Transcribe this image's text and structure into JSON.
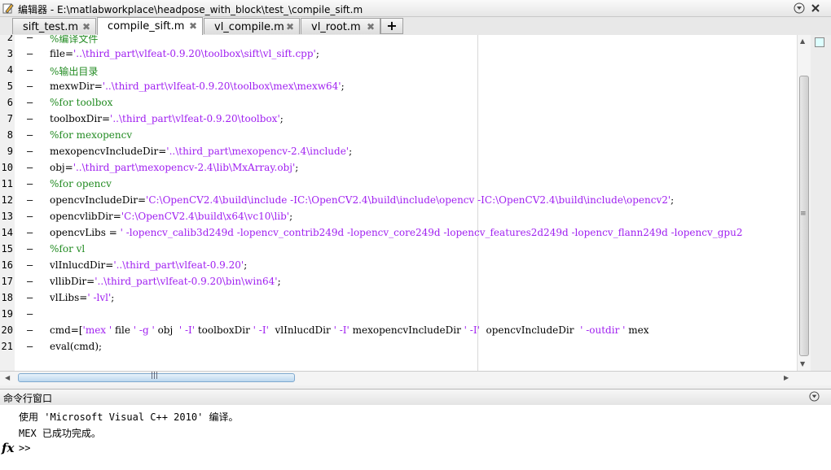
{
  "window": {
    "title": "编辑器 - E:\\matlabworkplace\\headpose_with_block\\test_\\compile_sift.m",
    "menu_icon": "chevron-down-icon",
    "close_icon": "close-icon"
  },
  "tabs": [
    {
      "label": "sift_test.m",
      "active": false
    },
    {
      "label": "compile_sift.m",
      "active": true
    },
    {
      "label": "vl_compile.m",
      "active": false
    },
    {
      "label": "vl_root.m",
      "active": false
    }
  ],
  "tab_close_glyph": "✖",
  "add_tab_label": "+",
  "editor": {
    "lines": [
      {
        "num": "2",
        "segments": [
          {
            "t": "cmt",
            "v": "%编译文件"
          }
        ]
      },
      {
        "num": "3",
        "segments": [
          {
            "t": "plain",
            "v": "file="
          },
          {
            "t": "str",
            "v": "'..\\third_part\\vlfeat-0.9.20\\toolbox\\sift\\vl_sift.cpp'"
          },
          {
            "t": "plain",
            "v": ";"
          }
        ]
      },
      {
        "num": "4",
        "segments": [
          {
            "t": "cmt",
            "v": "%输出目录"
          }
        ]
      },
      {
        "num": "5",
        "segments": [
          {
            "t": "plain",
            "v": "mexwDir="
          },
          {
            "t": "str",
            "v": "'..\\third_part\\vlfeat-0.9.20\\toolbox\\mex\\mexw64'"
          },
          {
            "t": "plain",
            "v": ";"
          }
        ]
      },
      {
        "num": "6",
        "segments": [
          {
            "t": "cmt",
            "v": "%for toolbox"
          }
        ]
      },
      {
        "num": "7",
        "segments": [
          {
            "t": "plain",
            "v": "toolboxDir="
          },
          {
            "t": "str",
            "v": "'..\\third_part\\vlfeat-0.9.20\\toolbox'"
          },
          {
            "t": "plain",
            "v": ";"
          }
        ]
      },
      {
        "num": "8",
        "segments": [
          {
            "t": "cmt",
            "v": "%for mexopencv"
          }
        ]
      },
      {
        "num": "9",
        "segments": [
          {
            "t": "plain",
            "v": "mexopencvIncludeDir="
          },
          {
            "t": "str",
            "v": "'..\\third_part\\mexopencv-2.4\\include'"
          },
          {
            "t": "plain",
            "v": ";"
          }
        ]
      },
      {
        "num": "10",
        "segments": [
          {
            "t": "plain",
            "v": "obj="
          },
          {
            "t": "str",
            "v": "'..\\third_part\\mexopencv-2.4\\lib\\MxArray.obj'"
          },
          {
            "t": "plain",
            "v": ";"
          }
        ]
      },
      {
        "num": "11",
        "segments": [
          {
            "t": "cmt",
            "v": "%for opencv"
          }
        ]
      },
      {
        "num": "12",
        "segments": [
          {
            "t": "plain",
            "v": "opencvIncludeDir="
          },
          {
            "t": "str",
            "v": "'C:\\OpenCV2.4\\build\\include -IC:\\OpenCV2.4\\build\\include\\opencv -IC:\\OpenCV2.4\\build\\include\\opencv2'"
          },
          {
            "t": "plain",
            "v": ";"
          }
        ]
      },
      {
        "num": "13",
        "segments": [
          {
            "t": "plain",
            "v": "opencvlibDir="
          },
          {
            "t": "str",
            "v": "'C:\\OpenCV2.4\\build\\x64\\vc10\\lib'"
          },
          {
            "t": "plain",
            "v": ";"
          }
        ]
      },
      {
        "num": "14",
        "segments": [
          {
            "t": "plain",
            "v": "opencvLibs = "
          },
          {
            "t": "str",
            "v": "' -lopencv_calib3d249d -lopencv_contrib249d -lopencv_core249d -lopencv_features2d249d -lopencv_flann249d -lopencv_gpu2"
          }
        ]
      },
      {
        "num": "15",
        "segments": [
          {
            "t": "cmt",
            "v": "%for vl"
          }
        ]
      },
      {
        "num": "16",
        "segments": [
          {
            "t": "plain",
            "v": "vlInlucdDir="
          },
          {
            "t": "str",
            "v": "'..\\third_part\\vlfeat-0.9.20'"
          },
          {
            "t": "plain",
            "v": ";"
          }
        ]
      },
      {
        "num": "17",
        "segments": [
          {
            "t": "plain",
            "v": "vllibDir="
          },
          {
            "t": "str",
            "v": "'..\\third_part\\vlfeat-0.9.20\\bin\\win64'"
          },
          {
            "t": "plain",
            "v": ";"
          }
        ]
      },
      {
        "num": "18",
        "segments": [
          {
            "t": "plain",
            "v": "vlLibs="
          },
          {
            "t": "str",
            "v": "' -lvl'"
          },
          {
            "t": "plain",
            "v": ";"
          }
        ]
      },
      {
        "num": "19",
        "segments": []
      },
      {
        "num": "20",
        "segments": [
          {
            "t": "plain",
            "v": "cmd=["
          },
          {
            "t": "str",
            "v": "'mex '"
          },
          {
            "t": "plain",
            "v": " file "
          },
          {
            "t": "str",
            "v": "' -g '"
          },
          {
            "t": "plain",
            "v": " obj  "
          },
          {
            "t": "str",
            "v": "' -I'"
          },
          {
            "t": "plain",
            "v": " toolboxDir "
          },
          {
            "t": "str",
            "v": "' -I'"
          },
          {
            "t": "plain",
            "v": "  vlInlucdDir "
          },
          {
            "t": "str",
            "v": "' -I'"
          },
          {
            "t": "plain",
            "v": " mexopencvIncludeDir "
          },
          {
            "t": "str",
            "v": "' -I'"
          },
          {
            "t": "plain",
            "v": "  opencvIncludeDir  "
          },
          {
            "t": "str",
            "v": "' -outdir '"
          },
          {
            "t": "plain",
            "v": " mex"
          }
        ]
      },
      {
        "num": "21",
        "segments": [
          {
            "t": "plain",
            "v": "eval(cmd);"
          }
        ]
      }
    ]
  },
  "command_window": {
    "title": "命令行窗口",
    "output": [
      "使用 'Microsoft Visual C++ 2010' 编译。",
      "MEX 已成功完成。"
    ],
    "fx_label": "fx",
    "prompt": ">>"
  },
  "colors": {
    "string": "#a020f0",
    "comment": "#228b22"
  }
}
